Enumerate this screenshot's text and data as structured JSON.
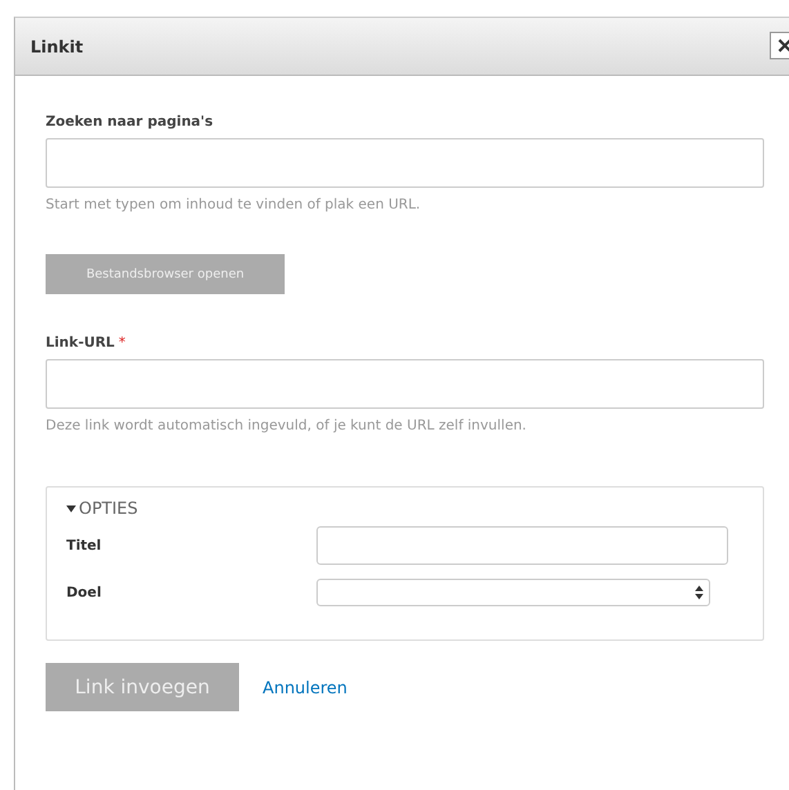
{
  "dialog": {
    "title": "Linkit"
  },
  "search": {
    "label": "Zoeken naar pagina's",
    "hint": "Start met typen om inhoud te vinden of plak een URL."
  },
  "browse_button": {
    "label": "Bestandsbrowser openen",
    "disabled": true
  },
  "url": {
    "label": "Link-URL",
    "required_mark": "*",
    "hint": "Deze link wordt automatisch ingevuld, of je kunt de URL zelf invullen."
  },
  "options": {
    "legend": "OPTIES",
    "expanded": true,
    "fields": [
      {
        "label": "Titel",
        "kind": "text"
      },
      {
        "label": "Doel",
        "kind": "select"
      }
    ]
  },
  "actions": {
    "submit": {
      "label": "Link invoegen",
      "disabled": true
    },
    "cancel": {
      "label": "Annuleren"
    }
  }
}
